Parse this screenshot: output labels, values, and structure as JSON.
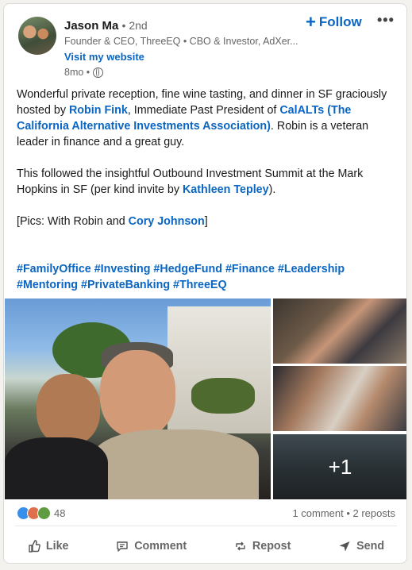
{
  "post": {
    "author": {
      "name": "Jason Ma",
      "degree": "• 2nd",
      "headline": "Founder & CEO, ThreeEQ • CBO & Investor, AdXer...",
      "website_link": "Visit my website",
      "timestamp": "8mo •"
    },
    "follow_label": "Follow",
    "more_label": "•••",
    "body": {
      "p1_a": "Wonderful private reception, fine wine tasting, and dinner in SF graciously hosted by ",
      "p1_link1": "Robin Fink",
      "p1_b": ", Immediate Past President of ",
      "p1_link2": "CalALTs (The California Alternative Investments Association)",
      "p1_c": ". Robin is a veteran leader in finance and a great guy.",
      "p2_a": "This followed the insightful Outbound Investment Summit at the Mark Hopkins in SF (per kind invite by ",
      "p2_link": "Kathleen Tepley",
      "p2_b": ").",
      "p3_a": "[Pics: With Robin and ",
      "p3_link": "Cory Johnson",
      "p3_b": "]",
      "hashtags_line1": "#FamilyOffice #Investing #HedgeFund #Finance #Leadership",
      "hashtags_line2": "#Mentoring #PrivateBanking #ThreeEQ"
    },
    "photos": {
      "more_count": "+1"
    },
    "social": {
      "reaction_count": "48",
      "comments_reposts": "1 comment • 2 reposts"
    },
    "actions": {
      "like": "Like",
      "comment": "Comment",
      "repost": "Repost",
      "send": "Send"
    }
  }
}
